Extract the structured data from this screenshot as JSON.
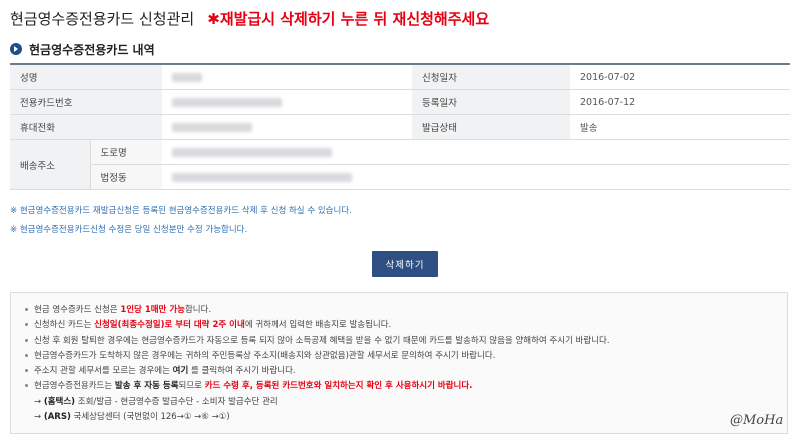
{
  "header": {
    "title": "현금영수증전용카드 신청관리",
    "warning": "✱재발급시 삭제하기 누른 뒤 재신청해주세요"
  },
  "section": {
    "title": "현금영수증전용카드 내역"
  },
  "table": {
    "name_label": "성명",
    "card_label": "전용카드번호",
    "phone_label": "휴대전화",
    "address_label": "배송주소",
    "road_label": "도로명",
    "lot_label": "법정동",
    "apply_date_label": "신청일자",
    "apply_date": "2016-07-02",
    "reg_date_label": "등록일자",
    "reg_date": "2016-07-12",
    "status_label": "발급상태",
    "status": "발송"
  },
  "notes": [
    "※ 현금영수증전용카드 재발급신청은 등록된 현금영수증전용카드 삭제 후 신청 하실 수 있습니다.",
    "※ 현금영수증전용카드신청 수정은 당일 신청분만 수정 가능합니다."
  ],
  "delete_button": "삭제하기",
  "guide": {
    "l1_a": "현금 영수증카드 신청은 ",
    "l1_red": "1인당 1매만 가능",
    "l1_b": "합니다.",
    "l2_a": "신청하신 카드는 ",
    "l2_red": "신청일(최종수정일)로 부터 대략 2주 이내",
    "l2_b": "에 귀하께서 입력한 배송지로 발송됩니다.",
    "l3": "신청 후 회원 탈퇴한 경우에는 현금영수증카드가 자동으로 등록 되지 않아 소득공제 혜택을 받을 수 없기 때문에 카드를 발송하지 않음을 양해하여 주시기 바랍니다.",
    "l4": "현금영수증카드가 도착하지 않은 경우에는 귀하의 주민등록상 주소지(배송지와 상관없음)관할 세무서로 문의하여 주시기 바랍니다.",
    "l5_a": "주소지 관할 세무서를 모르는 경우에는 ",
    "l5_bold": "여기",
    "l5_b": " 를 클릭하여 주시기 바랍니다.",
    "l6_a": "현금영수증전용카드는 ",
    "l6_bold": "발송 후 자동 등록",
    "l6_b": "되므로 ",
    "l6_red": "카드 수령 후, 등록된 카드번호와 일치하는지 확인 후 사용하시기 바랍니다.",
    "l7_a": "→ ",
    "l7_bold": "(홈택스)",
    "l7_b": " 조회/발급 - 현금영수증 발급수단 - 소비자 발급수단 관리",
    "l8_a": "→ ",
    "l8_bold": "(ARS)",
    "l8_b": " 국세상담센터 (국번없이 126→① →⑥ →①)"
  },
  "watermark": "@MoHa",
  "colors": {
    "warning": "#e60012",
    "button": "#2e4f83",
    "note": "#2f6fb0",
    "header_bullet": "#1f4e8c"
  }
}
